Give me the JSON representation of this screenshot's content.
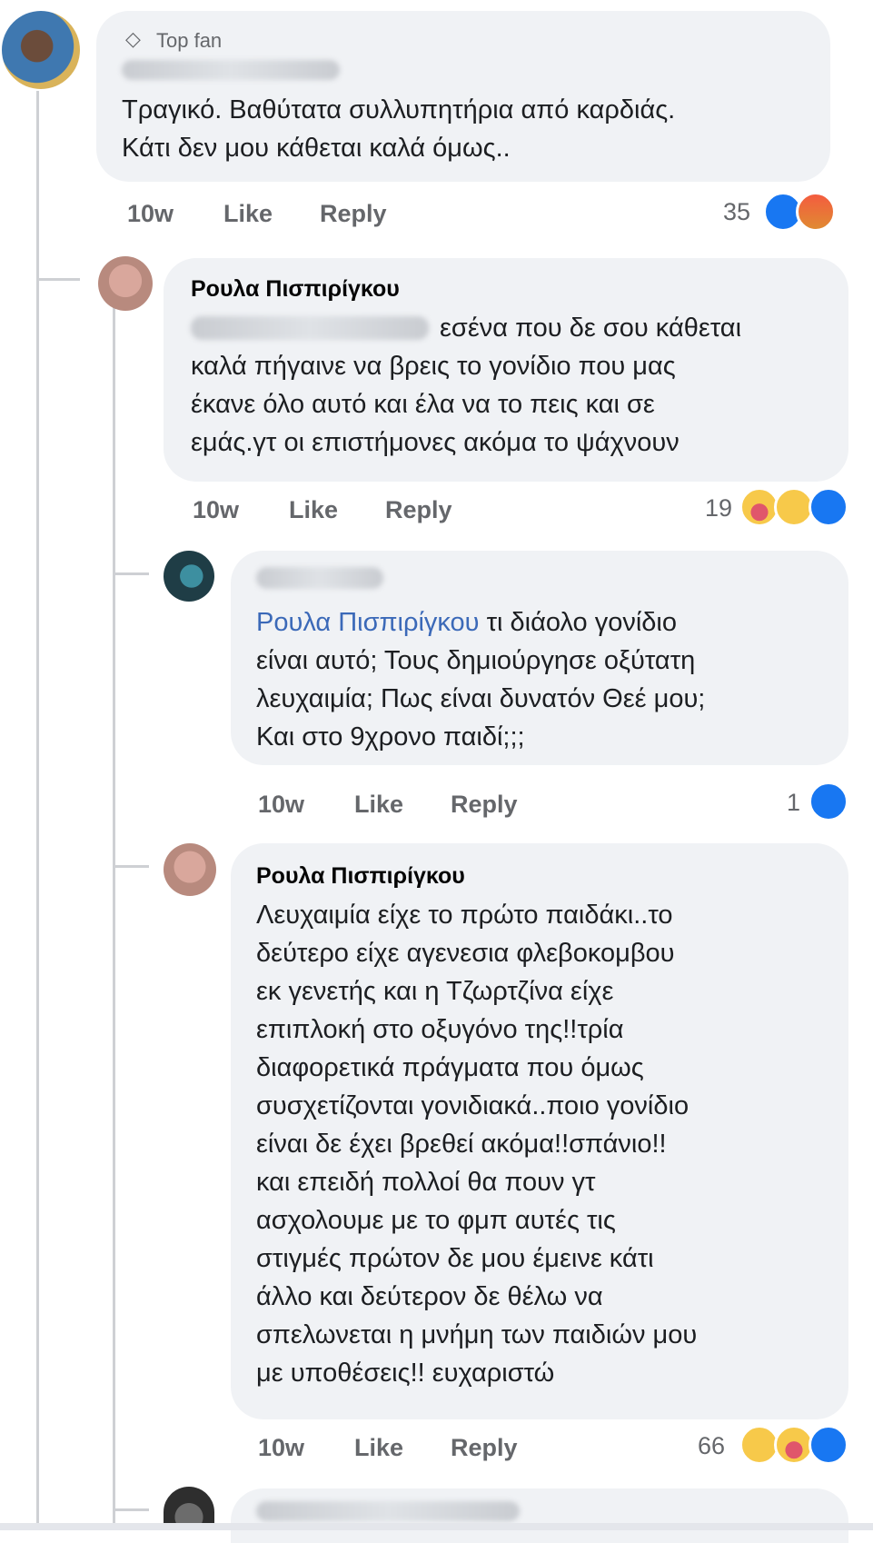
{
  "comment1": {
    "badge": "Top fan",
    "lines": [
      "Τραγικό. Βαθύτατα συλλυπητήρια από καρδιάς.",
      "Κάτι δεν μου κάθεται καλά όμως.."
    ],
    "time": "10w",
    "like": "Like",
    "reply": "Reply",
    "count": "35"
  },
  "reply1": {
    "author": "Ρουλα Πισπιρίγκου",
    "line1_rest": "εσένα που δε σου κάθεται",
    "lines": [
      "καλά πήγαινε να βρεις το γονίδιο που μας",
      "έκανε όλο αυτό και έλα να το πεις και σε",
      "εμάς.γτ οι επιστήμονες ακόμα το ψάχνουν"
    ],
    "time": "10w",
    "like": "Like",
    "reply": "Reply",
    "count": "19"
  },
  "reply2": {
    "mention": "Ρουλα Πισπιρίγκου",
    "line1_rest": " τι διάολο γονίδιο",
    "lines": [
      "είναι αυτό; Τους δημιούργησε οξύτατη",
      "λευχαιμία; Πως είναι δυνατόν Θεέ μου;",
      "Και στο 9χρονο παιδί;;;"
    ],
    "time": "10w",
    "like": "Like",
    "reply": "Reply",
    "count": "1"
  },
  "reply3": {
    "author": "Ρουλα Πισπιρίγκου",
    "lines": [
      "Λευχαιμία είχε το πρώτο παιδάκι..το",
      "δεύτερο είχε αγενεσια φλεβοκομβου",
      "εκ γενετής και η Τζωρτζίνα είχε",
      "επιπλοκή στο οξυγόνο της!!τρία",
      "διαφορετικά πράγματα που όμως",
      "συσχετίζονται γονιδιακά..ποιο γονίδιο",
      "είναι δε έχει βρεθεί ακόμα!!σπάνιο!!",
      "και επειδή πολλοί θα πουν γτ",
      "ασχολουμε με το φμπ αυτές τις",
      "στιγμές πρώτον δε μου έμεινε κάτι",
      "άλλο και δεύτερον δε θέλω να",
      "σπελωνεται η μνήμη των παιδιών μου",
      "με υποθέσεις!! ευχαριστώ"
    ],
    "time": "10w",
    "like": "Like",
    "reply": "Reply",
    "count": "66"
  },
  "colors": {
    "like": "#1877f2",
    "mention": "#3b69b8",
    "bubble": "#f0f2f5"
  }
}
